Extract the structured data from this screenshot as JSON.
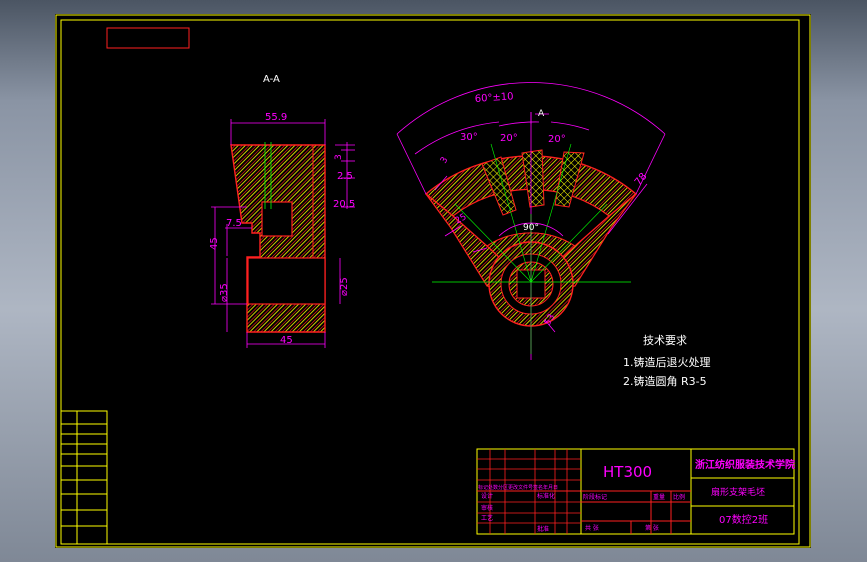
{
  "section_label": "A-A",
  "view_marker": "A",
  "dims": {
    "width_top": "55.9",
    "d_3": "3",
    "d_2_5": "2.5",
    "d_20_5": "20.5",
    "d_7_5": "7.5",
    "d_45_v": "45",
    "d_phi_d": "⌀35",
    "d_phi_25": "⌀25",
    "d_45_h": "45",
    "arc_60": "60°±10",
    "ang_30": "30°",
    "ang_20a": "20°",
    "ang_20b": "20°",
    "ang_90": "90°",
    "r_78": "78",
    "r_3": "3",
    "r_25": "25",
    "r_53": "53"
  },
  "notes": {
    "title": "技术要求",
    "line1": "1.铸造后退火处理",
    "line2": "2.铸造圆角 R3-5"
  },
  "title_block": {
    "material": "HT300",
    "school": "浙江纺织服装技术学院",
    "part_name": "扇形支架毛坯",
    "class_name": "07数控2班",
    "rows": [
      "标记处数分区更改文件号签名年月日",
      "设计",
      "标准化",
      "审核",
      "工艺",
      "批准"
    ],
    "cells": [
      "阶段标记",
      "重量",
      "比例",
      "共 张",
      "第 张"
    ]
  },
  "colors": {
    "frame": "#ffff00",
    "dimension": "#ff00ff",
    "outline": "#ff2020",
    "hatch": "#ffff00",
    "center": "#00ff00",
    "text": "#ffffff"
  }
}
